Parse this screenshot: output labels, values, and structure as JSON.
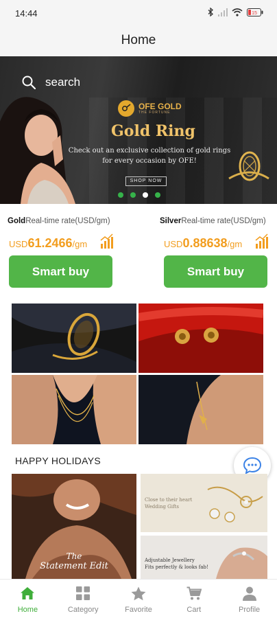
{
  "status_bar": {
    "time": "14:44",
    "battery": "15"
  },
  "header": {
    "title": "Home"
  },
  "banner": {
    "search_label": "search",
    "brand_name": "OFE GOLD",
    "brand_sub": "THE FORTUNE",
    "title": "Gold Ring",
    "subtitle": "Check out an exclusive collection of gold rings for every occasion by OFE!",
    "cta": "SHOP NOW",
    "slide_count": 4,
    "active_slide": 3
  },
  "rates": {
    "gold": {
      "metal": "Gold",
      "label": "Real-time rate(USD/gm)",
      "currency": "USD",
      "value": "61.2466",
      "unit": "/gm",
      "button": "Smart buy"
    },
    "silver": {
      "metal": "Silver",
      "label": "Real-time rate(USD/gm)",
      "currency": "USD",
      "value": "0.88638",
      "unit": "/gm",
      "button": "Smart buy"
    }
  },
  "section": {
    "title": "HAPPY HOLIDAYS"
  },
  "promos": {
    "statement": {
      "line1": "The",
      "line2": "Statement Edit"
    },
    "wedding": {
      "line1": "Close to their heart",
      "line2": "Wedding Gifts"
    },
    "adjustable": {
      "line1": "Adjustable Jewellery",
      "line2": "Fits perfectly & looks fab!"
    }
  },
  "nav": {
    "items": [
      {
        "label": "Home",
        "icon": "home-icon",
        "active": true
      },
      {
        "label": "Category",
        "icon": "category-grid-icon",
        "active": false
      },
      {
        "label": "Favorite",
        "icon": "star-icon",
        "active": false
      },
      {
        "label": "Cart",
        "icon": "cart-icon",
        "active": false
      },
      {
        "label": "Profile",
        "icon": "person-icon",
        "active": false
      }
    ]
  },
  "colors": {
    "accent": "#52b548",
    "rate": "#f29d1e",
    "nav_active": "#3fae3a",
    "banner_gold": "#f0c36a"
  }
}
